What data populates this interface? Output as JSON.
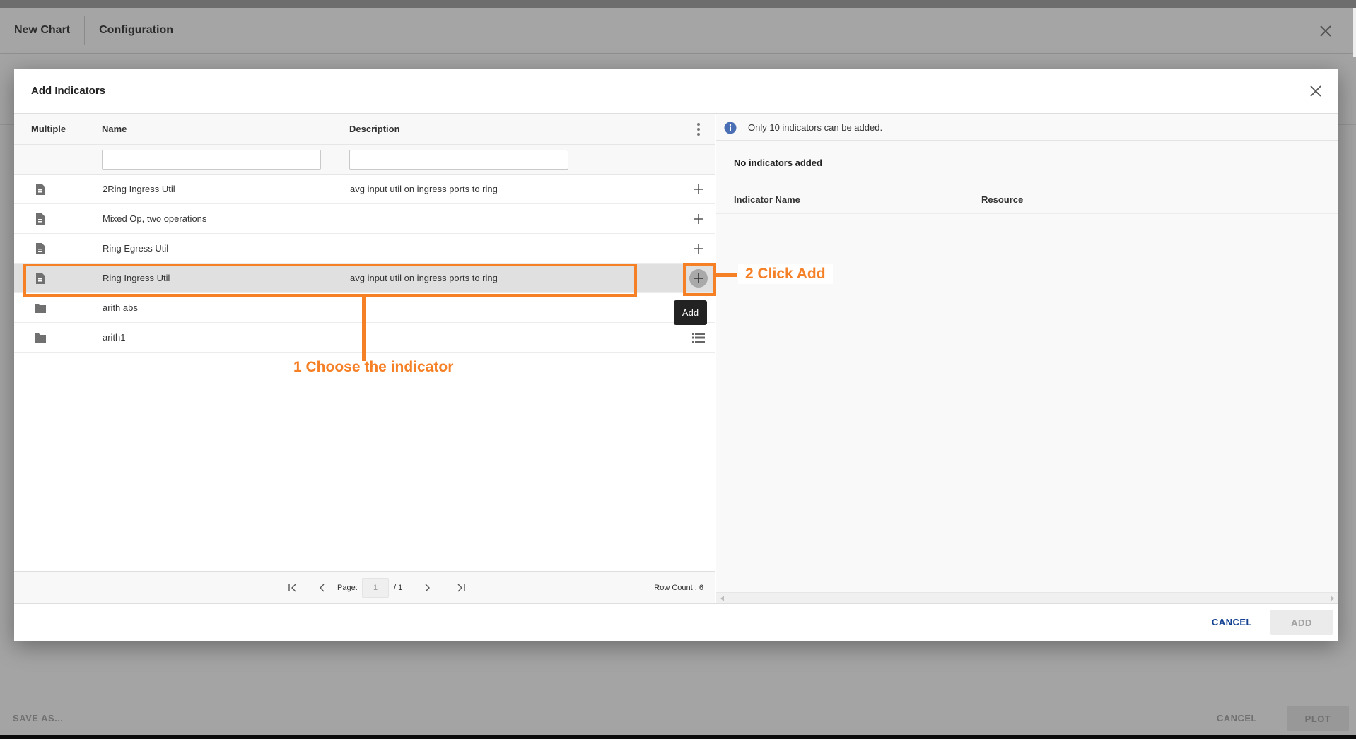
{
  "app": {
    "title": "New Chart",
    "tab": "Configuration",
    "footer": {
      "save_as": "SAVE AS...",
      "cancel": "CANCEL",
      "plot": "PLOT"
    }
  },
  "modal": {
    "title": "Add Indicators",
    "columns": {
      "multiple": "Multiple",
      "name": "Name",
      "description": "Description"
    },
    "filters": {
      "name_value": "",
      "description_value": ""
    },
    "rows": [
      {
        "type": "file-icon",
        "name": "2Ring Ingress Util",
        "description": "avg input util on ingress ports to ring",
        "action": "plus-icon",
        "selected": false
      },
      {
        "type": "file-icon",
        "name": "Mixed Op, two operations",
        "description": "",
        "action": "plus-icon",
        "selected": false
      },
      {
        "type": "file-icon",
        "name": "Ring Egress Util",
        "description": "",
        "action": "plus-icon",
        "selected": false
      },
      {
        "type": "file-icon",
        "name": "Ring Ingress Util",
        "description": "avg input util on ingress ports to ring",
        "action": "plus-icon",
        "selected": true
      },
      {
        "type": "folder-icon",
        "name": "arith abs",
        "description": "",
        "action": "",
        "selected": false
      },
      {
        "type": "folder-icon",
        "name": "arith1",
        "description": "",
        "action": "list-icon",
        "selected": false
      }
    ],
    "tooltip": "Add",
    "pager": {
      "page_label": "Page:",
      "page_value": "1",
      "total": "/ 1",
      "row_count": "Row Count : 6"
    },
    "right": {
      "info": "Only 10 indicators can be added.",
      "empty": "No indicators added",
      "col_indicator_name": "Indicator Name",
      "col_resource": "Resource"
    },
    "footer": {
      "cancel": "CANCEL",
      "add": "ADD"
    }
  },
  "annotations": {
    "step1": "1 Choose the indicator",
    "step2": "2 Click Add",
    "color": "#f58025"
  }
}
